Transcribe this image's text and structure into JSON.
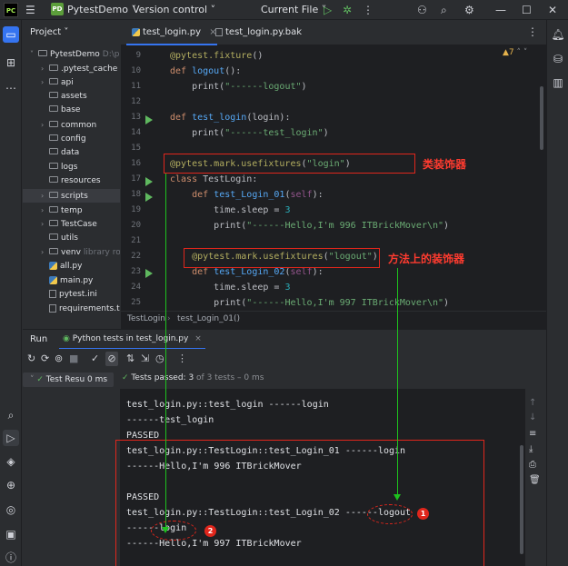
{
  "app": {
    "logo_text": "PC",
    "project_badge": "PD",
    "project_name": "PytestDemo",
    "version_control": "Version control",
    "current_file": "Current File"
  },
  "sidebar_title": "Project",
  "tree": [
    {
      "label": "PytestDemo",
      "suffix": "D:\\p",
      "kind": "folder",
      "arrow": "˅",
      "indent": 0
    },
    {
      "label": ".pytest_cache",
      "kind": "folder",
      "arrow": "›",
      "indent": 1
    },
    {
      "label": "api",
      "kind": "folder",
      "arrow": "›",
      "indent": 1
    },
    {
      "label": "assets",
      "kind": "folder",
      "arrow": "",
      "indent": 1
    },
    {
      "label": "base",
      "kind": "folder",
      "arrow": "",
      "indent": 1
    },
    {
      "label": "common",
      "kind": "folder",
      "arrow": "›",
      "indent": 1
    },
    {
      "label": "config",
      "kind": "folder",
      "arrow": "",
      "indent": 1
    },
    {
      "label": "data",
      "kind": "folder",
      "arrow": "",
      "indent": 1
    },
    {
      "label": "logs",
      "kind": "folder",
      "arrow": "",
      "indent": 1
    },
    {
      "label": "resources",
      "kind": "folder",
      "arrow": "",
      "indent": 1
    },
    {
      "label": "scripts",
      "kind": "folder",
      "arrow": "›",
      "indent": 1
    },
    {
      "label": "temp",
      "kind": "folder",
      "arrow": "›",
      "indent": 1
    },
    {
      "label": "TestCase",
      "kind": "folder",
      "arrow": "›",
      "indent": 1
    },
    {
      "label": "utils",
      "kind": "folder",
      "arrow": "",
      "indent": 1
    },
    {
      "label": "venv",
      "suffix": "library ro",
      "kind": "folder",
      "arrow": "›",
      "indent": 1
    },
    {
      "label": "all.py",
      "kind": "py",
      "arrow": "",
      "indent": 1
    },
    {
      "label": "main.py",
      "kind": "py",
      "arrow": "",
      "indent": 1
    },
    {
      "label": "pytest.ini",
      "kind": "txt",
      "arrow": "",
      "indent": 1
    },
    {
      "label": "requirements.t",
      "kind": "txt",
      "arrow": "",
      "indent": 1
    }
  ],
  "tabs": [
    {
      "label": "test_login.py",
      "active": true
    },
    {
      "label": "test_login.py.bak",
      "active": false
    }
  ],
  "inspection": "▲7",
  "code": [
    {
      "ln": "9",
      "html": "<span class=\"dec\">@pytest.fixture</span>()"
    },
    {
      "ln": "10",
      "html": "<span class=\"kw\">def</span> <span class=\"fn\">logout</span>():"
    },
    {
      "ln": "11",
      "html": "    print(<span class=\"str\">\"------logout\"</span>)"
    },
    {
      "ln": "12",
      "html": ""
    },
    {
      "ln": "13",
      "html": "<span class=\"kw\">def</span> <span class=\"fn\">test_login</span>(login):"
    },
    {
      "ln": "14",
      "html": "    print(<span class=\"str\">\"------test_login\"</span>)"
    },
    {
      "ln": "15",
      "html": ""
    },
    {
      "ln": "16",
      "html": "<span class=\"dec\">@pytest.mark.usefixtures</span>(<span class=\"str\">\"login\"</span>)"
    },
    {
      "ln": "17",
      "html": "<span class=\"kw\">class</span> TestLogin:"
    },
    {
      "ln": "18",
      "html": "    <span class=\"kw\">def</span> <span class=\"fn\">test_Login_01</span>(<span class=\"slf\">self</span>):"
    },
    {
      "ln": "19",
      "html": "        time.sleep = <span class=\"num\">3</span>"
    },
    {
      "ln": "20",
      "html": "        print(<span class=\"str\">\"------Hello,I'm 996 ITBrickMover\\n\"</span>)"
    },
    {
      "ln": "21",
      "html": ""
    },
    {
      "ln": "22",
      "html": "    <span class=\"dec\">@pytest.mark.usefixtures</span>(<span class=\"str\">\"logout\"</span>)"
    },
    {
      "ln": "23",
      "html": "    <span class=\"kw\">def</span> <span class=\"fn\">test_Login_02</span>(<span class=\"slf\">self</span>):"
    },
    {
      "ln": "24",
      "html": "        time.sleep = <span class=\"num\">3</span>"
    },
    {
      "ln": "25",
      "html": "        print(<span class=\"str\">\"------Hello,I'm 997 ITBrickMover\\n\"</span>)"
    }
  ],
  "breadcrumb": [
    "TestLogin",
    "test_Login_01()"
  ],
  "run": {
    "title": "Run",
    "tab_label": "Python tests in test_login.py",
    "tree_item": "Test Resu",
    "tree_time": "0 ms",
    "status_prefix": "Tests passed: ",
    "status_passed": "3",
    "status_suffix": " of 3 tests – 0 ms"
  },
  "console": [
    "test_login.py::test_login ------login",
    "------test_login",
    "PASSED",
    "test_login.py::TestLogin::test_Login_01 ------login",
    "------Hello,I'm 996 ITBrickMover",
    "",
    "PASSED",
    "test_login.py::TestLogin::test_Login_02 ------logout",
    "------login",
    "------Hello,I'm 997 ITBrickMover"
  ],
  "annotations": {
    "class_decorator": "类装饰器",
    "method_decorator": "方法上的装饰器",
    "badge1": "1",
    "badge2": "2"
  },
  "colors": {
    "accent": "#3574f0",
    "annotation": "#e0261c",
    "arrow": "#1ec21e"
  }
}
